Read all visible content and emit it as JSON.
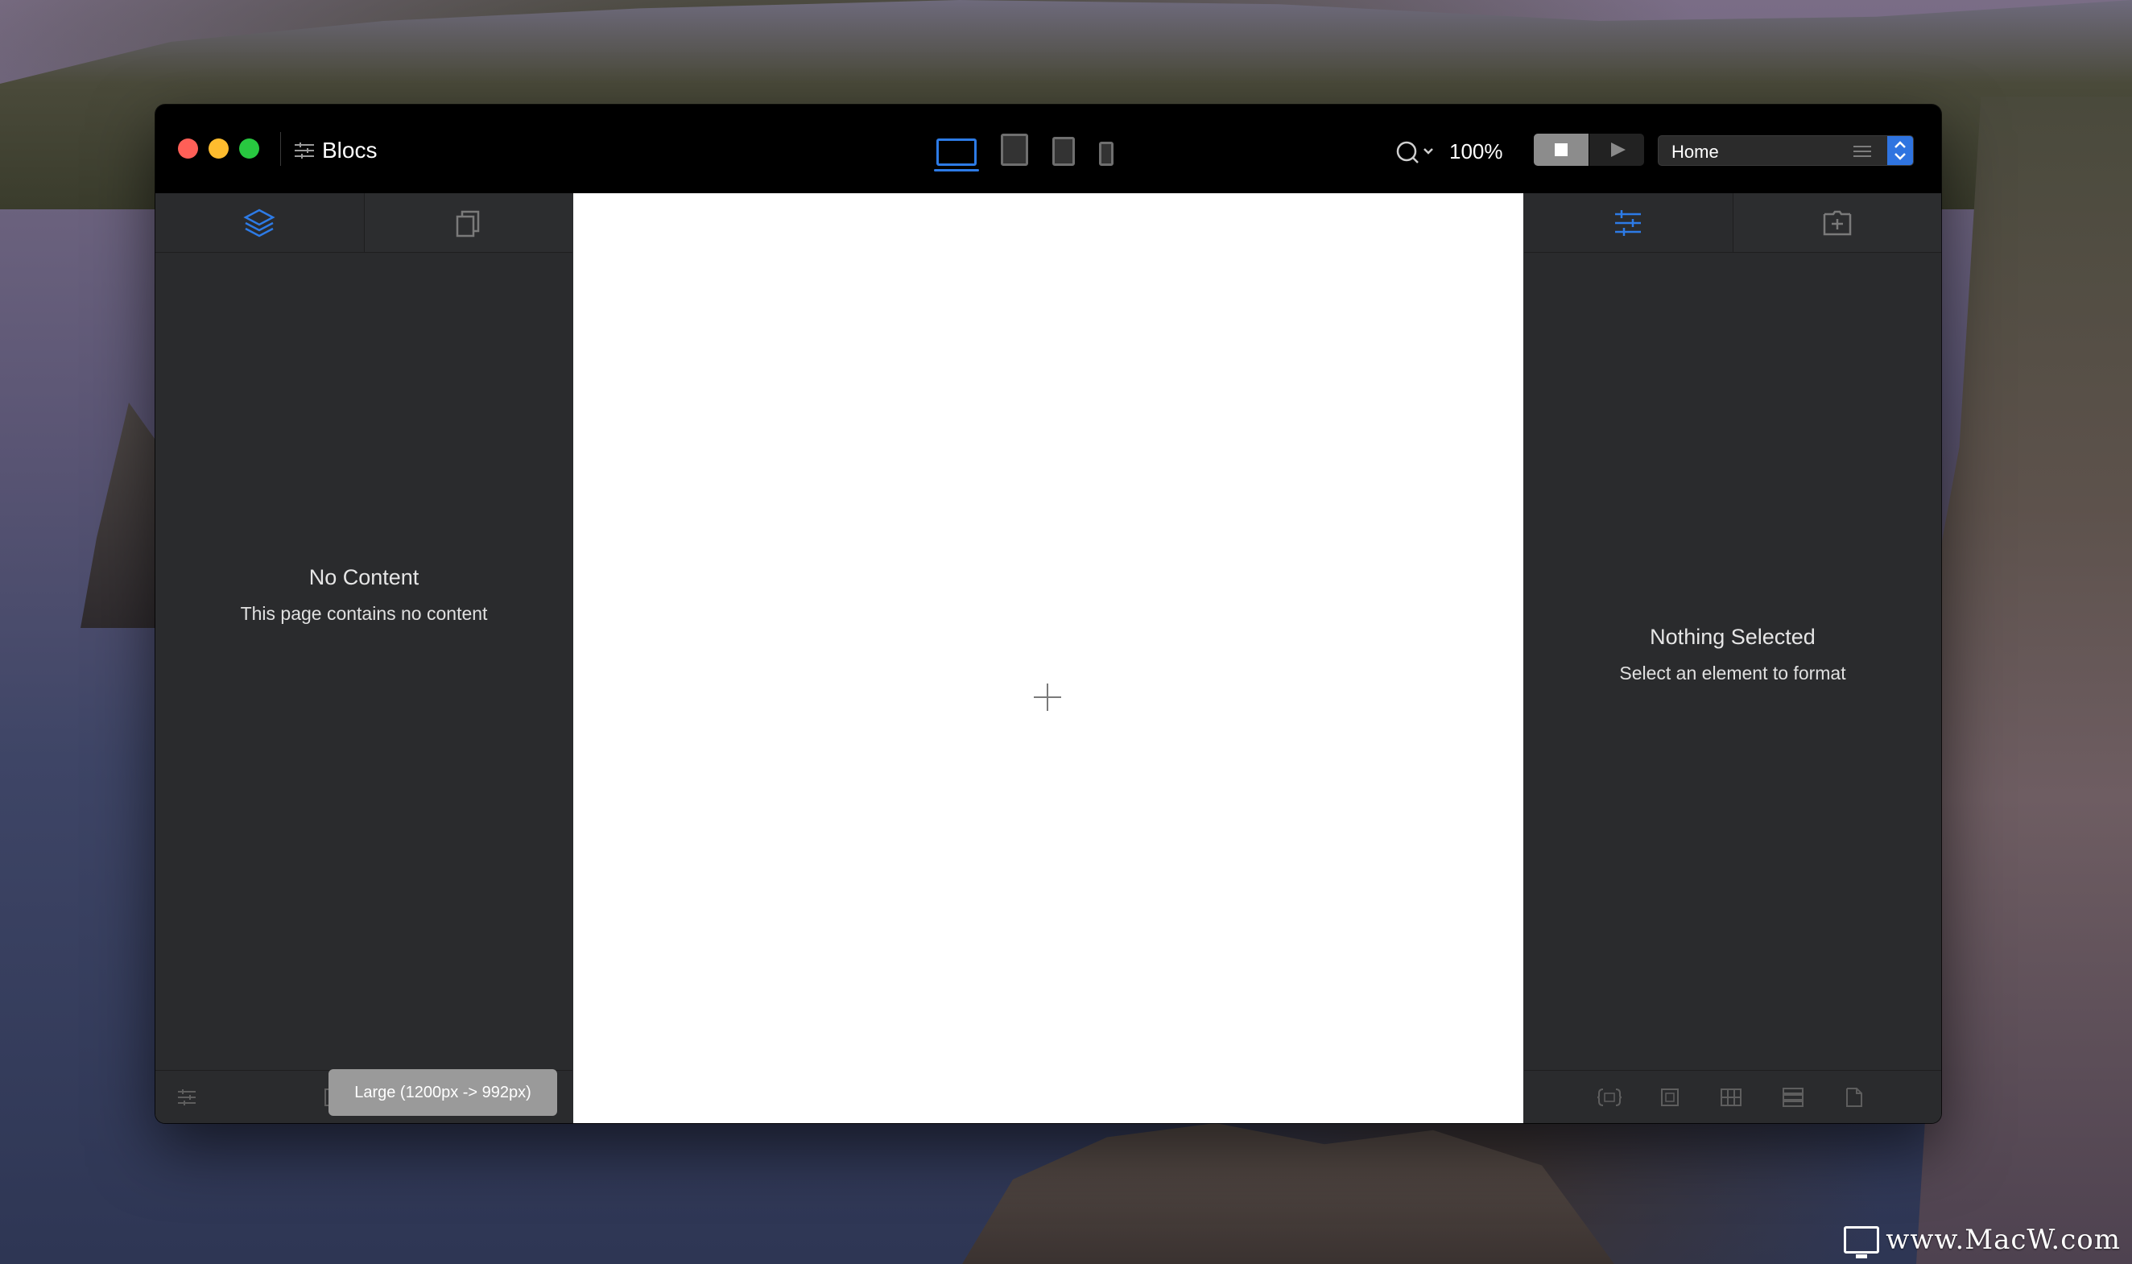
{
  "app": {
    "title": "Blocs"
  },
  "toolbar": {
    "devices": [
      {
        "name": "desktop",
        "active": true
      },
      {
        "name": "tablet-landscape",
        "active": false
      },
      {
        "name": "tablet-portrait",
        "active": false
      },
      {
        "name": "phone",
        "active": false
      }
    ],
    "zoom": "100%",
    "page_select": "Home",
    "accent_color": "#2d7be6"
  },
  "left_panel": {
    "tabs": [
      {
        "icon": "layers-icon",
        "active": true
      },
      {
        "icon": "pages-icon",
        "active": false
      }
    ],
    "empty_title": "No Content",
    "empty_subtitle": "This page contains no content",
    "footer_icons": [
      "settings-icon",
      "columns-icon",
      "insert-icon",
      "trash-icon"
    ]
  },
  "canvas": {
    "breakpoint_label": "Large (1200px -> 992px)"
  },
  "right_panel": {
    "tabs": [
      {
        "icon": "sliders-icon",
        "active": true
      },
      {
        "icon": "add-bric-icon",
        "active": false
      }
    ],
    "empty_title": "Nothing Selected",
    "empty_subtitle": "Select an element to format",
    "footer_icons": [
      "code-icon",
      "container-icon",
      "grid-icon",
      "rows-icon",
      "document-icon"
    ]
  },
  "watermark": "www.MacW.com"
}
